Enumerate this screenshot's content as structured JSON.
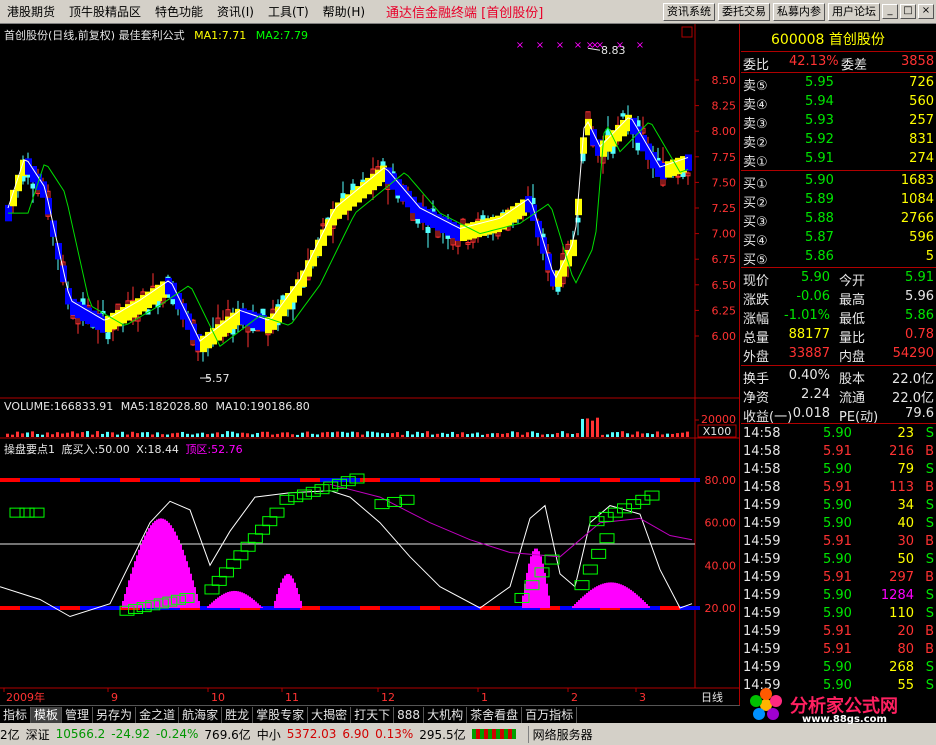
{
  "menu": {
    "items": [
      "港股期货",
      "顶牛股精品区",
      "特色功能",
      "资讯(I)",
      "工具(T)",
      "帮助(H)"
    ],
    "title": "通达信金融终端 [首创股份]",
    "buttons": [
      "资讯系统",
      "委托交易",
      "私募内参",
      "用户论坛"
    ],
    "window_controls": [
      "_",
      "□",
      "×"
    ]
  },
  "chart": {
    "header": "首创股份(日线,前复权) 最佳套利公式",
    "ma1": "MA1:7.71",
    "ma2": "MA2:7.79",
    "y_ticks": [
      "8.50",
      "8.25",
      "8.00",
      "7.75",
      "7.50",
      "7.25",
      "7.00",
      "6.75",
      "6.50",
      "6.25",
      "6.00"
    ],
    "high_label": "8.83",
    "low_label": "5.57",
    "volume_header": {
      "vol": "VOLUME:166833.91",
      "ma5": "MA5:182028.80",
      "ma10": "MA10:190186.80"
    },
    "volume_tick": "20000",
    "volume_unit": "X100",
    "indicator_header": {
      "name": "操盘要点1",
      "buy": "底买入:50.00",
      "x": "X:18.44",
      "top": "顶区:52.76"
    },
    "indicator_ticks": [
      "80.00",
      "60.00",
      "40.00",
      "20.00"
    ],
    "x_labels": [
      "2009年",
      "9",
      "10",
      "11",
      "12",
      "1",
      "2",
      "3"
    ],
    "period": "日线"
  },
  "chart_data": {
    "type": "line",
    "title": "首创股份(日线,前复权) 最佳套利公式",
    "price": {
      "high": 8.83,
      "low": 5.57,
      "ylim": [
        5.57,
        8.83
      ],
      "ma1": 7.71,
      "ma2": 7.79
    },
    "indicator": {
      "ylim": [
        0,
        100
      ],
      "levels": [
        20,
        50,
        80
      ],
      "buy": 50.0,
      "x": 18.44,
      "top": 52.76
    }
  },
  "quote": {
    "code": "600008 首创股份",
    "wb_label": "委比",
    "wb_value": "42.13%",
    "wc_label": "委差",
    "wc_value": "3858",
    "sells": [
      {
        "label": "卖⑤",
        "price": "5.95",
        "vol": "726"
      },
      {
        "label": "卖④",
        "price": "5.94",
        "vol": "560"
      },
      {
        "label": "卖③",
        "price": "5.93",
        "vol": "257"
      },
      {
        "label": "卖②",
        "price": "5.92",
        "vol": "831"
      },
      {
        "label": "卖①",
        "price": "5.91",
        "vol": "274"
      }
    ],
    "buys": [
      {
        "label": "买①",
        "price": "5.90",
        "vol": "1683"
      },
      {
        "label": "买②",
        "price": "5.89",
        "vol": "1084"
      },
      {
        "label": "买③",
        "price": "5.88",
        "vol": "2766"
      },
      {
        "label": "买④",
        "price": "5.87",
        "vol": "596"
      },
      {
        "label": "买⑤",
        "price": "5.86",
        "vol": "5"
      }
    ],
    "stats": [
      {
        "l1": "现价",
        "v1": "5.90",
        "c1": "c-green",
        "l2": "今开",
        "v2": "5.91",
        "c2": "c-green"
      },
      {
        "l1": "涨跌",
        "v1": "-0.06",
        "c1": "c-green",
        "l2": "最高",
        "v2": "5.96",
        "c2": "c-white"
      },
      {
        "l1": "涨幅",
        "v1": "-1.01%",
        "c1": "c-green",
        "l2": "最低",
        "v2": "5.86",
        "c2": "c-green"
      },
      {
        "l1": "总量",
        "v1": "88177",
        "c1": "c-yellow",
        "l2": "量比",
        "v2": "0.78",
        "c2": "c-red"
      },
      {
        "l1": "外盘",
        "v1": "33887",
        "c1": "c-red",
        "l2": "内盘",
        "v2": "54290",
        "c2": "c-red"
      }
    ],
    "fin": [
      {
        "l1": "换手",
        "v1": "0.40%",
        "l2": "股本",
        "v2": "22.0亿"
      },
      {
        "l1": "净资",
        "v1": "2.24",
        "l2": "流通",
        "v2": "22.0亿"
      },
      {
        "l1": "收益(一)",
        "v1": "0.018",
        "l2": "PE(动)",
        "v2": "79.6"
      }
    ],
    "ticks": [
      {
        "t": "14:58",
        "p": "5.90",
        "v": "23",
        "d": "S"
      },
      {
        "t": "14:58",
        "p": "5.91",
        "v": "216",
        "d": "B"
      },
      {
        "t": "14:58",
        "p": "5.90",
        "v": "79",
        "d": "S"
      },
      {
        "t": "14:58",
        "p": "5.91",
        "v": "113",
        "d": "B"
      },
      {
        "t": "14:59",
        "p": "5.90",
        "v": "34",
        "d": "S"
      },
      {
        "t": "14:59",
        "p": "5.90",
        "v": "40",
        "d": "S"
      },
      {
        "t": "14:59",
        "p": "5.91",
        "v": "30",
        "d": "B"
      },
      {
        "t": "14:59",
        "p": "5.90",
        "v": "50",
        "d": "S"
      },
      {
        "t": "14:59",
        "p": "5.91",
        "v": "297",
        "d": "B"
      },
      {
        "t": "14:59",
        "p": "5.90",
        "v": "1284",
        "d": "S"
      },
      {
        "t": "14:59",
        "p": "5.90",
        "v": "110",
        "d": "S"
      },
      {
        "t": "14:59",
        "p": "5.91",
        "v": "20",
        "d": "B"
      },
      {
        "t": "14:59",
        "p": "5.91",
        "v": "80",
        "d": "B"
      },
      {
        "t": "14:59",
        "p": "5.90",
        "v": "268",
        "d": "S"
      },
      {
        "t": "14:59",
        "p": "5.90",
        "v": "55",
        "d": "S"
      }
    ]
  },
  "tabs": [
    "指标",
    "模板",
    "管理",
    "另存为",
    "金之道",
    "航海家",
    "胜龙",
    "掌股专家",
    "大揭密",
    "打天下",
    "888",
    "大机构",
    "茶舍看盘",
    "百万指标"
  ],
  "status": {
    "prefix": "2亿",
    "index_name": "深证",
    "index_value": "10566.2",
    "index_change": "-24.92",
    "index_pct": "-0.24%",
    "index_amount": "769.6亿",
    "zx_name": "中小",
    "zx_value": "5372.03",
    "zx_change": "6.90",
    "zx_pct": "0.13%",
    "zx_amount": "295.5亿",
    "server": "网络服务器"
  },
  "watermark": {
    "text": "分析家公式网",
    "url": "www.88gs.com"
  },
  "colors": {
    "up": "#ff3232",
    "down": "#00e600",
    "bg": "#000000",
    "border": "#b00000"
  }
}
